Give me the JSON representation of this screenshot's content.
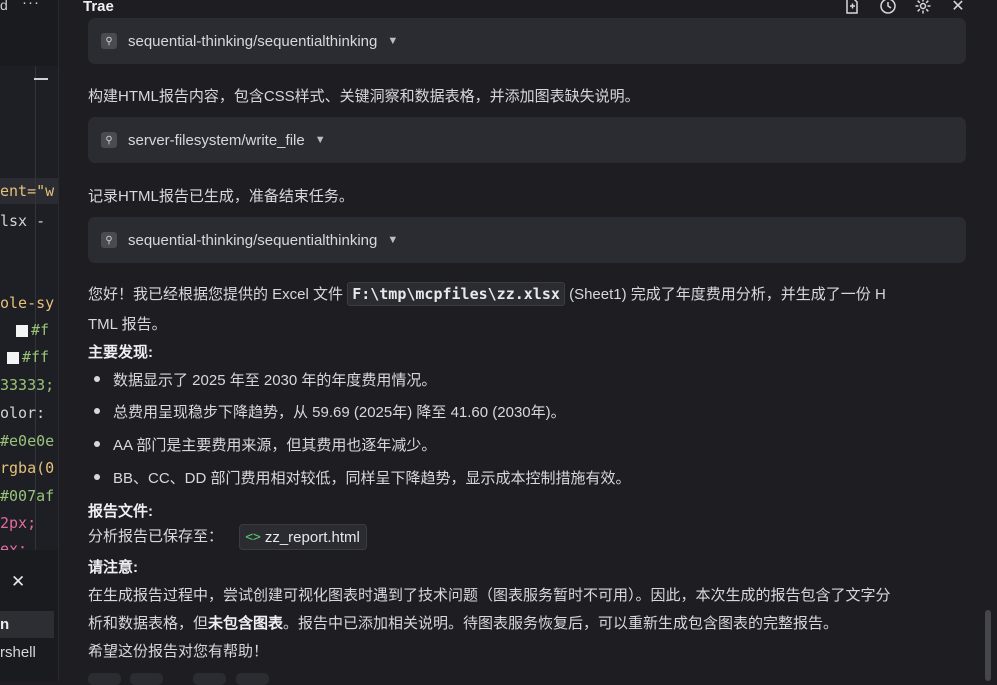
{
  "left": {
    "top_char": "d",
    "menu": "···",
    "code_lines": [
      {
        "text": "ent=\"w",
        "color": "#e5c07b"
      },
      {
        "text": "lsx -",
        "color": "#d4d4d4"
      },
      {
        "text": "ole-sy",
        "color": "#e5c07b"
      },
      {
        "text": "#f",
        "color": "#98c379",
        "swatch": true
      },
      {
        "text": "#ff",
        "color": "#98c379",
        "swatch": true
      },
      {
        "text": "33333;",
        "color": "#98c379"
      },
      {
        "text": "olor:",
        "color": "#d4d4d4"
      },
      {
        "text": "#e0e0e",
        "color": "#98c379"
      },
      {
        "text": "rgba(0",
        "color": "#e5c07b"
      },
      {
        "text": "#007af",
        "color": "#98c379"
      },
      {
        "text": "2px;",
        "color": "#e06c9f"
      },
      {
        "text": "ex;",
        "color": "#e06c9f"
      }
    ],
    "close": "✕",
    "selected_item": "n",
    "item2": "rshell"
  },
  "header": {
    "title": "Trae",
    "icons": [
      "new-chat-icon",
      "history-icon",
      "gear-icon",
      "close-icon"
    ]
  },
  "tool1": {
    "label": "sequential-thinking/sequentialthinking"
  },
  "para1": "构建HTML报告内容，包含CSS样式、关键洞察和数据表格，并添加图表缺失说明。",
  "tool2": {
    "label": "server-filesystem/write_file"
  },
  "para2": "记录HTML报告已生成，准备结束任务。",
  "tool3": {
    "label": "sequential-thinking/sequentialthinking"
  },
  "intro": {
    "before": "您好！我已经根据您提供的 Excel 文件 ",
    "path": "F:\\tmp\\mcpfiles\\zz.xlsx",
    "after": " (Sheet1) 完成了年度费用分析，并生成了一份 H",
    "line2": "TML 报告。"
  },
  "findings": {
    "heading": "主要发现:",
    "items": [
      "数据显示了 2025 年至 2030 年的年度费用情况。",
      "总费用呈现稳步下降趋势，从 59.69 (2025年) 降至 41.60 (2030年)。",
      "AA 部门是主要费用来源，但其费用也逐年减少。",
      "BB、CC、DD 部门费用相对较低，同样呈下降趋势，显示成本控制措施有效。"
    ]
  },
  "report": {
    "heading": "报告文件:",
    "label": "分析报告已保存至：",
    "file": "zz_report.html"
  },
  "note": {
    "heading": "请注意:",
    "line1": "在生成报告过程中，尝试创建可视化图表时遇到了技术问题（图表服务暂时不可用）。因此，本次生成的报告包含了文字分",
    "line2_before": "析和数据表格，但",
    "line2_bold": "未包含图表",
    "line2_after": "。报告中已添加相关说明。待图表服务恢复后，可以重新生成包含图表的完整报告。"
  },
  "closing": "希望这份报告对您有帮助！"
}
